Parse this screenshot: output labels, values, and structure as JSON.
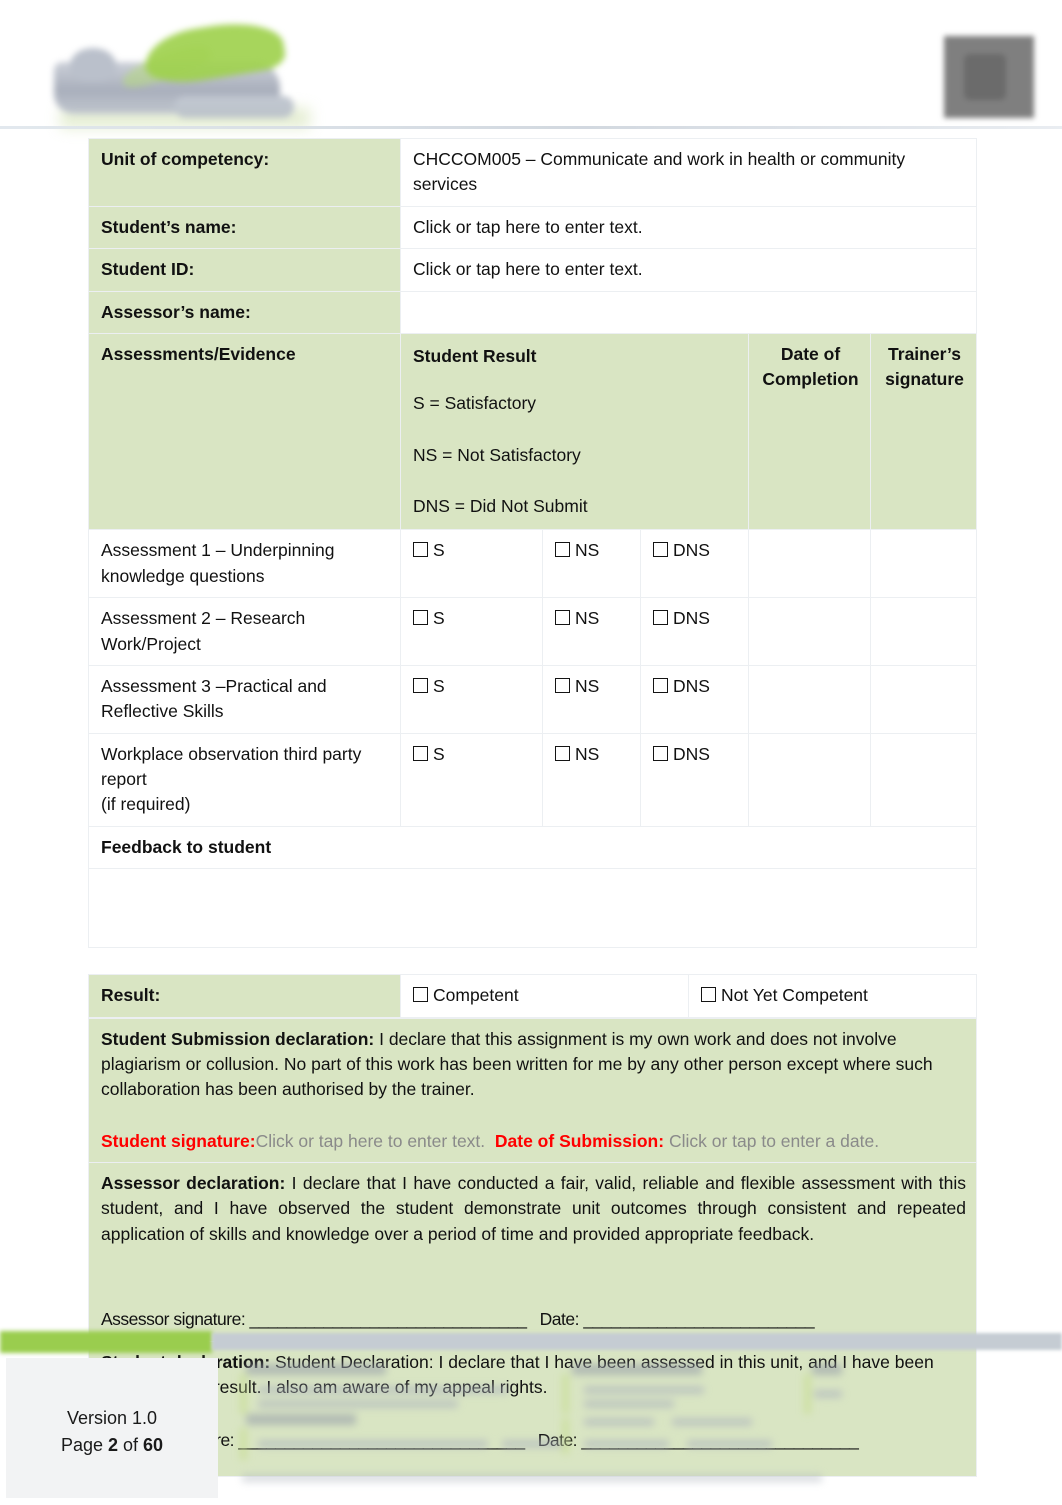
{
  "document": {
    "header": {
      "logo_left_name": "company-logo",
      "logo_right_name": "secondary-logo"
    },
    "footer": {
      "version": "Version 1.0",
      "page_prefix": "Page ",
      "page_current": "2",
      "page_middle": " of ",
      "page_total": "60"
    }
  },
  "colors": {
    "cell_green": "#D9E5C3",
    "required_red": "#FF0000",
    "placeholder_grey": "#8A8A8A",
    "footer_green": "#9ACD4E",
    "footer_grey": "#C5CCD3"
  },
  "form": {
    "unit_label": "Unit of competency:",
    "unit_value": "CHCCOM005 – Communicate and work in health or community services",
    "student_name_label": "Student’s name:",
    "student_name_placeholder": "Click or tap here to enter text.",
    "student_id_label": "Student ID:",
    "student_id_placeholder": "Click or tap here to enter text.",
    "assessor_name_label": "Assessor’s name:",
    "assessor_name_value": "",
    "assessments_header": "Assessments/Evidence",
    "student_result_header": "Student Result",
    "legend": [
      "S = Satisfactory",
      "NS = Not Satisfactory",
      "DNS = Did Not Submit"
    ],
    "date_of_completion_header": "Date of Completion",
    "trainer_signature_header": "Trainer’s signature",
    "checkbox_options": [
      "S",
      "NS",
      "DNS"
    ],
    "rows": [
      {
        "label": "Assessment 1 – Underpinning knowledge questions",
        "s": "S",
        "ns": "NS",
        "dns": "DNS",
        "date": "",
        "signature": ""
      },
      {
        "label": "Assessment 2 – Research Work/Project",
        "s": "S",
        "ns": "NS",
        "dns": "DNS",
        "date": "",
        "signature": ""
      },
      {
        "label": "Assessment 3 –Practical and Reflective Skills",
        "s": "S",
        "ns": "NS",
        "dns": "DNS",
        "date": "",
        "signature": ""
      },
      {
        "label": "Workplace observation third party report (if required)",
        "label_line1": "Workplace observation third party report",
        "label_line2": "(if required)",
        "s": "S",
        "ns": "NS",
        "dns": "DNS",
        "date": "",
        "signature": ""
      }
    ],
    "feedback_label": "Feedback to student",
    "feedback_value": "",
    "result_label": "Result:",
    "result_option_competent": "Competent",
    "result_option_not_yet_competent": "Not Yet Competent"
  },
  "declarations": {
    "student_submission": {
      "title": "Student Submission declaration:",
      "body": " I declare that this assignment is my own work and does not involve plagiarism or collusion. No part of this work has been written for me by any other person except where such collaboration has been authorised by the trainer.",
      "signature_label": "Student signature:",
      "signature_placeholder": "Click or tap here to enter text.",
      "date_label": "Date of Submission:",
      "date_placeholder": " Click or tap to enter a date."
    },
    "assessor": {
      "title": "Assessor declaration:",
      "body": " I declare that I have conducted a fair, valid, reliable and flexible assessment with this student, and I have observed the student demonstrate unit outcomes through consistent and repeated application of skills and knowledge over a period of time and provided appropriate feedback.",
      "signature_label": "Assessor signature: ______________________________",
      "date_label": "Date: _________________________"
    },
    "student": {
      "title": "Student declaration:",
      "body": " Student Declaration: I declare that I have been assessed in this unit, and I have been advised of my result. I also am aware of my appeal rights.",
      "signature_label": "Student signature: _______________________________",
      "date_label": "Date: ______________________________"
    }
  }
}
